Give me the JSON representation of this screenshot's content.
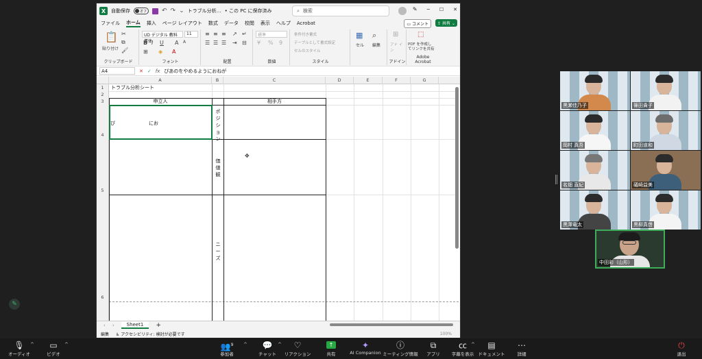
{
  "excel": {
    "autosave_label": "自動保存",
    "autosave_state": "オフ",
    "file_title": "トラブル分析…",
    "save_status": "• この PC に保存済み",
    "search_placeholder": "検索",
    "menu": [
      "ファイル",
      "ホーム",
      "挿入",
      "ページ レイアウト",
      "数式",
      "データ",
      "校閲",
      "表示",
      "ヘルプ",
      "Acrobat"
    ],
    "active_tab": "ホーム",
    "comment_label": "コメント",
    "share_label": "共有",
    "ribbon": {
      "paste": "貼り付け",
      "clipboard": "クリップボード",
      "font_name": "UD デジタル 教科書体",
      "font_size": "11",
      "font_group": "フォント",
      "align_group": "配置",
      "number_format": "標準",
      "number_group": "数値",
      "cond_format": "条件付き書式",
      "table_format": "テーブルとして書式設定",
      "cell_styles": "セルのスタイル",
      "styles_group": "スタイル",
      "cells": "セル",
      "editing": "編集",
      "addins": "アド イン",
      "addins_group": "アドイン",
      "pdf_create": "PDF を作成し",
      "pdf_link": "てリンクを共有",
      "acrobat_group": "Adobe Acrobat"
    },
    "namebox": "A4",
    "formula": "ぴあのをやめるようにおねが",
    "columns": [
      "A",
      "B",
      "C",
      "D",
      "E",
      "F",
      "G"
    ],
    "rows": [
      "1",
      "2",
      "3",
      "4",
      "5",
      "6"
    ],
    "cells": {
      "a1": "トラブル分析シート",
      "a3": "申立人",
      "c3": "相手方",
      "a4_start": "ぴ",
      "a4_mid": "にお"
    },
    "labels_b": {
      "position": [
        "ポ",
        "ジ",
        "シ",
        "ョ",
        "ン"
      ],
      "value": [
        "価",
        "値",
        "観"
      ],
      "needs": [
        "ニ",
        "ー",
        "ズ"
      ]
    },
    "sheet_tab": "Sheet1",
    "status_mode": "編集",
    "accessibility": "アクセシビリティ: 検討が必要です",
    "zoom": "100%"
  },
  "gallery": [
    {
      "name": "黒瀬佳乃子"
    },
    {
      "name": "篠田貴子"
    },
    {
      "name": "岡村 真吾"
    },
    {
      "name": "町田道和"
    },
    {
      "name": "名畑 直紀"
    },
    {
      "name": "礒崎益美"
    },
    {
      "name": "黒澤竜太"
    },
    {
      "name": "黒柳真啓"
    }
  ],
  "active_speaker": {
    "name": "中田彩（山形）"
  },
  "zoombar": {
    "audio": "オーディオ",
    "video": "ビデオ",
    "participants": "参加者",
    "participants_count": "9",
    "chat": "チャット",
    "reactions": "リアクション",
    "share": "共有",
    "ai": "AI Companion",
    "meeting_info": "ミーティング情報",
    "apps": "アプリ",
    "captions": "字幕を表示",
    "documents": "ドキュメント",
    "more": "詳細",
    "leave": "退出"
  },
  "colors": {
    "excel_green": "#107c41",
    "zoom_share": "#28a745",
    "speaker_border": "#3fae5a",
    "leave": "#e04040"
  }
}
